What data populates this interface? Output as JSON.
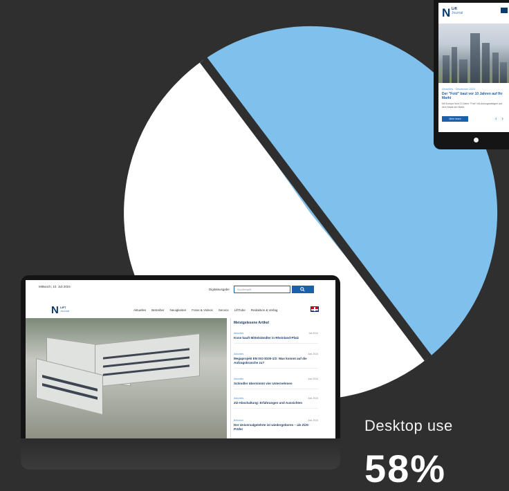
{
  "pie": {
    "colors": {
      "desktop": "#7fc1ec",
      "other": "#ffffff",
      "divider": "#2f2f2f",
      "background": "#2f2f2f"
    }
  },
  "stat": {
    "label": "Desktop use",
    "value": "58%"
  },
  "tablet": {
    "logo_mark": "N",
    "logo_line1": "Lift",
    "logo_line2": "Journal",
    "meta": "Aktuelles · Dezember 2024",
    "title": "Der \"Fold\" baut vor 10 Jahren auf Ihr Markt",
    "teaser": "Mit Europa fand 10 Jahre \"Fold\" mit Aufzugsanlagen auf dem Markt am Markt.",
    "button": "Mehr lesen",
    "prev": "‹",
    "next": "›"
  },
  "laptop": {
    "date": "Mittwoch, 10. Juli 2024",
    "digital_label": "Digitalausgabe",
    "search_placeholder": "Suchbegriff",
    "logo_mark": "N",
    "logo_line1": "LIFT",
    "logo_line2": "Journal",
    "nav": [
      "Aktuelles",
      "Betreiber",
      "Neuigkeiten",
      "Fotos & Videos",
      "Service",
      "LiftTube",
      "Redaktion & Verlag"
    ],
    "sidebar_title": "Meistgelesene Artikel",
    "articles": [
      {
        "category": "Aktuelles",
        "date": "Juli 2024",
        "title": "Kone kauft Mittelständler in Rheinland-Pfalz"
      },
      {
        "category": "Aktuelles",
        "date": "Juni 2024",
        "title": "Megaprojekt EN ISO 8100-1/2: Was kommt auf die Aufzugsbranche zu?"
      },
      {
        "category": "Aktuelles",
        "date": "Juni 2024",
        "title": "Schindler übernimmt vier Unternehmen"
      },
      {
        "category": "Aktuelles",
        "date": "Juni 2024",
        "title": "ZÜ-Abschaltung: Erfahrungen und Aussichten"
      },
      {
        "category": "Betreiber",
        "date": "Juni 2024",
        "title": "Der Universalgelehrte ist wiedergeboren – als ZÜS-Prüfer"
      }
    ]
  }
}
